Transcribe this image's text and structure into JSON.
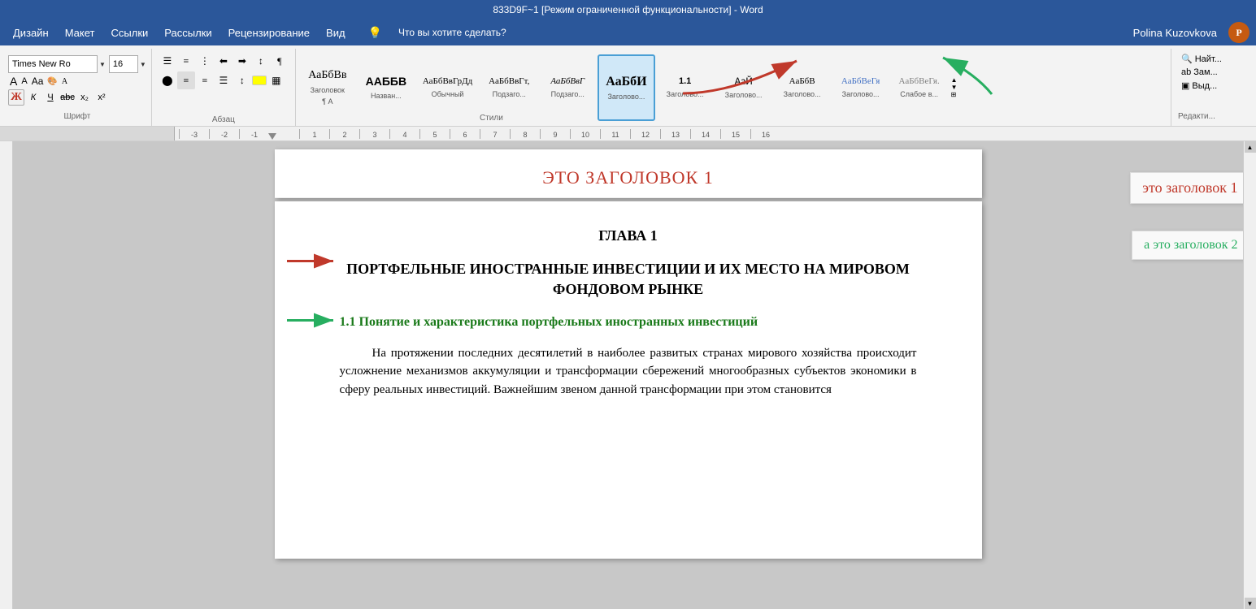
{
  "titlebar": {
    "text": "833D9F~1 [Режим ограниченной функциональности] - Word"
  },
  "menubar": {
    "items": [
      "Дизайн",
      "Макет",
      "Ссылки",
      "Рассылки",
      "Рецензирование",
      "Вид"
    ],
    "help_label": "Что вы хотите сделать?",
    "user": "Polina Kuzovkova"
  },
  "ribbon": {
    "font_name": "Times New Ro",
    "font_size": "16",
    "format_buttons": {
      "bold": "Ж",
      "italic": "К",
      "underline": "Ч",
      "strikethrough": "abc",
      "subscript": "x₂",
      "superscript": "x²"
    },
    "sections": {
      "font_label": "Шрифт",
      "paragraph_label": "Абзац",
      "styles_label": "Стили",
      "editing_label": "Редакти..."
    },
    "styles": [
      {
        "name": "¶ А",
        "label": "Заголовок"
      },
      {
        "name": "ААББВ",
        "label": "Назван..."
      },
      {
        "name": "¶ Обычный",
        "label": "Обычный"
      },
      {
        "name": "АаБбВвГт,",
        "label": "Подзаго..."
      },
      {
        "name": "АаБбВвГ",
        "label": "Подзаго..."
      },
      {
        "name": "АаБбИ",
        "label": "Заголово...",
        "active": true
      },
      {
        "name": "1.1",
        "label": "Заголово..."
      },
      {
        "name": "АаЙ",
        "label": "Заголово..."
      },
      {
        "name": "АаБбВ",
        "label": "Заголово..."
      },
      {
        "name": "АаБбВеГя",
        "label": "Заголово..."
      },
      {
        "name": "АаБбВеГя.",
        "label": "Слабое в..."
      }
    ]
  },
  "editing": {
    "find": "Найт...",
    "replace": "Зам...",
    "select": "Выд..."
  },
  "arrows": {
    "ribbon_red_arrow": "→",
    "ribbon_green_arrow": "↑",
    "doc_red_arrow": "→",
    "doc_green_arrow": "→"
  },
  "callouts": {
    "heading1": "это заголовок 1",
    "heading2": "а это заголовок 2"
  },
  "document": {
    "page1": {
      "heading1": "ЭТО ЗАГОЛОВОК 1"
    },
    "page2": {
      "chapter_title": "ГЛАВА 1",
      "chapter_subtitle": "ПОРТФЕЛЬНЫЕ ИНОСТРАННЫЕ ИНВЕСТИЦИИ И ИХ МЕСТО НА МИРОВОМ ФОНДОВОМ РЫНКЕ",
      "section_heading": "1.1   Понятие и характеристика портфельных иностранных инвестиций",
      "body_paragraph": "На протяжении последних десятилетий в наиболее развитых странах мирового хозяйства происходит усложнение механизмов аккумуляции и трансформации сбережений многообразных субъектов экономики в сферу реальных инвестиций. Важнейшим звеном данной трансформации при этом становится"
    }
  },
  "ruler": {
    "marks": [
      "-3",
      "-2",
      "-1",
      "",
      "1",
      "2",
      "3",
      "4",
      "5",
      "6",
      "7",
      "8",
      "9",
      "10",
      "11",
      "12",
      "13",
      "14",
      "15",
      "16"
    ]
  }
}
